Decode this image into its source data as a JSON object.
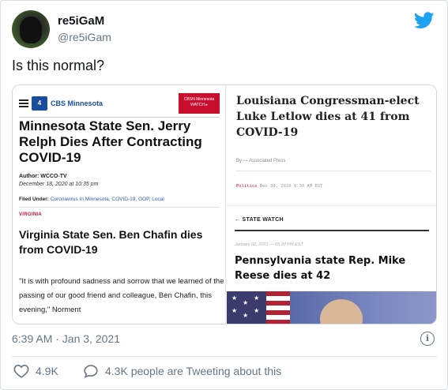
{
  "author": {
    "display_name": "re5iGaM",
    "handle": "@re5iGam"
  },
  "tweet_text": "Is this normal?",
  "media": {
    "left": {
      "station": "CBS Minnesota",
      "channel_num": "4",
      "cbsn_line1": "CBSN Minnesota",
      "cbsn_line2": "WATCH ▸",
      "headline_a": "Minnesota State Sen. Jerry Relph Dies After Contracting COVID-19",
      "author_line": "Author: WCCO-TV",
      "date_line": "December 18, 2020 at 10:35 pm",
      "filed_label": "Filed Under:",
      "filed_tags": "Coronavirus In Minnesota, COVID-19, GOP, Local",
      "section": "VIRGINIA",
      "headline_b": "Virginia State Sen. Ben Chafin dies from COVID-19",
      "quote": "\"It is with profound sadness and sorrow that we learned of the passing of our good friend and colleague, Ben Chafin, this evening,\" Norment"
    },
    "right_top": {
      "headline_c": "Louisiana Congressman-elect Luke Letlow dies at 41 from COVID-19",
      "byline": "By — Associated Press",
      "politics_tag": "Politics",
      "politics_date": "Dec 30, 2020 9:30 AM EST"
    },
    "right_bottom": {
      "section": "STATE WATCH",
      "date_line": "January 02, 2021 — 05:20 PM EST",
      "headline_d": "Pennsylvania state Rep. Mike Reese dies at 42"
    }
  },
  "timestamp": "6:39 AM · Jan 3, 2021",
  "likes": "4.9K",
  "tweeting": "4.3K people are Tweeting about this",
  "colors": {
    "twitter_blue": "#1da1f2",
    "cbs_blue": "#1a4d9c",
    "cbsn_red": "#c8102e"
  }
}
